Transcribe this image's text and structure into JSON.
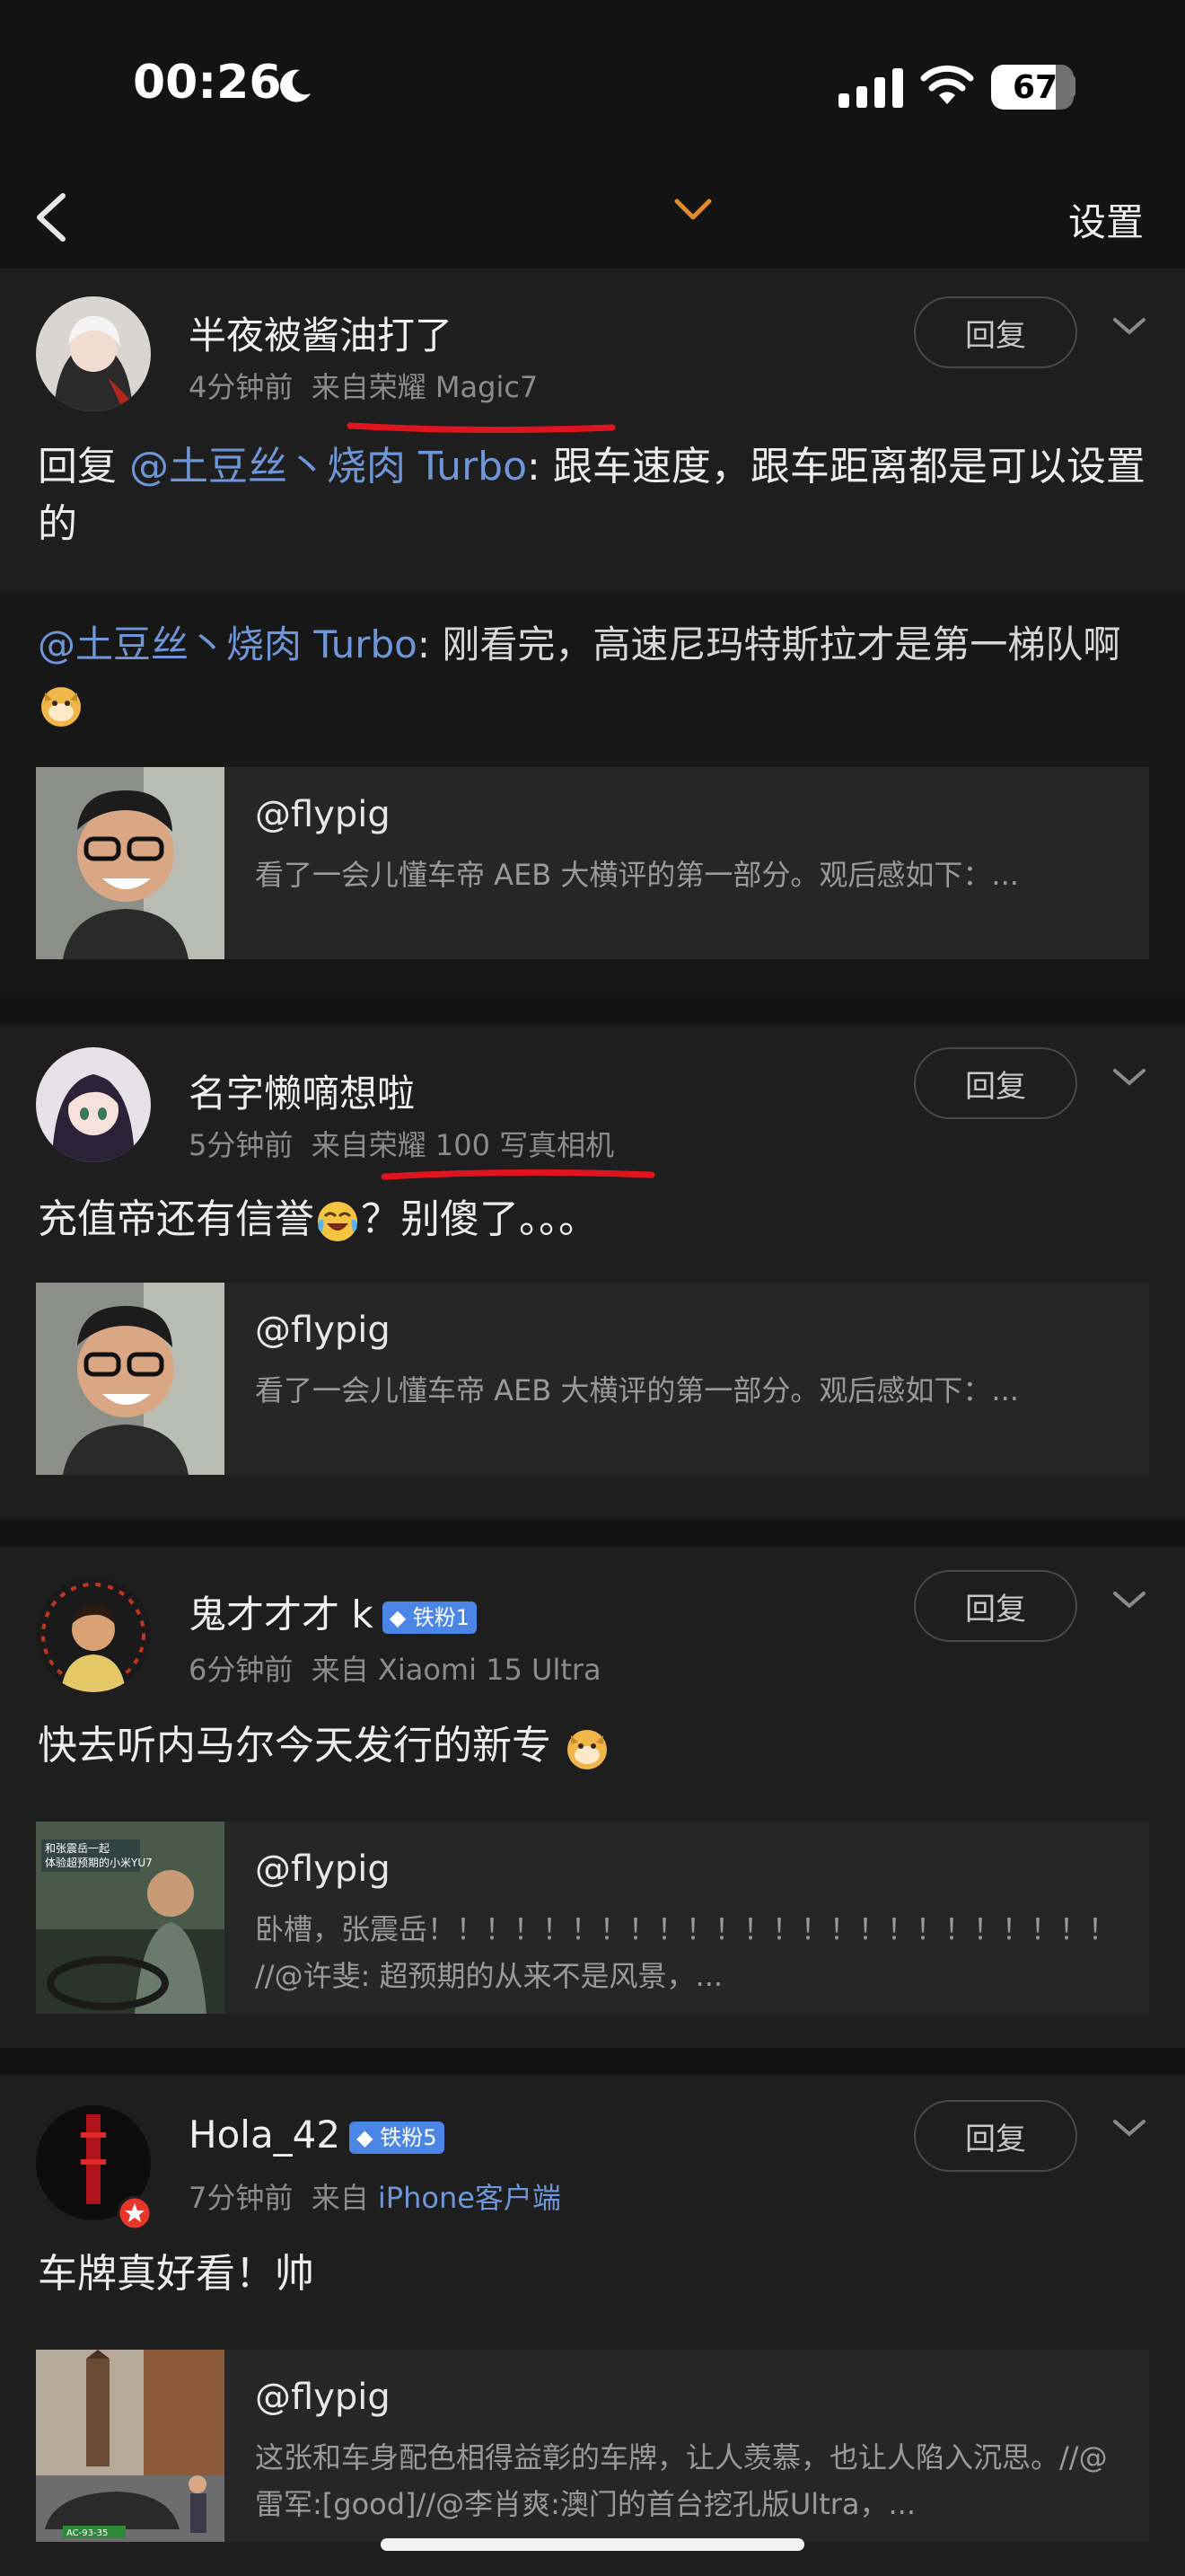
{
  "status_bar": {
    "time": "00:26",
    "battery": "67"
  },
  "nav": {
    "title": "",
    "settings_label": "设置"
  },
  "comments": [
    {
      "user": "半夜被酱油打了",
      "badge": "",
      "time": "4分钟前",
      "source_prefix": "来自",
      "device": "荣耀 Magic7",
      "reply_label": "回复",
      "text_prefix": "回复",
      "mention": "@土豆丝丶烧肉 Turbo",
      "text": ": 跟车速度，跟车距离都是可以设置的",
      "quote_mention": "@土豆丝丶烧肉 Turbo",
      "quote_text": ": 刚看完，高速尼玛特斯拉才是第一梯队啊",
      "orig_author": "@flypig",
      "orig_text": "看了一会儿懂车帝 AEB 大横评的第一部分。观后感如下：..."
    },
    {
      "user": "名字懒嘀想啦",
      "badge": "",
      "time": "5分钟前",
      "source_prefix": "来自",
      "device": "荣耀 100 写真相机",
      "reply_label": "回复",
      "text": "充值帝还有信誉",
      "text_suffix": "？别傻了。。。",
      "orig_author": "@flypig",
      "orig_text": "看了一会儿懂车帝 AEB 大横评的第一部分。观后感如下：..."
    },
    {
      "user": "鬼才才才 k",
      "badge": "铁粉1",
      "time": "6分钟前",
      "source_prefix": "来自",
      "device": "Xiaomi 15 Ultra",
      "reply_label": "回复",
      "text": "快去听内马尔今天发行的新专",
      "orig_author": "@flypig",
      "orig_text": "卧槽，张震岳！！！！！！！！！！！！！！！！！！！！！！！！ //@许斐: 超预期的从来不是风景，...",
      "orig_thumb_caption": "和张震岳一起 体验超预期的小米YU7"
    },
    {
      "user": "Hola_42",
      "badge": "铁粉5",
      "time": "7分钟前",
      "source_prefix": "来自",
      "device": "iPhone客户端",
      "reply_label": "回复",
      "text": "车牌真好看！帅",
      "orig_author": "@flypig",
      "orig_text": "这张和车身配色相得益彰的车牌，让人羡慕，也让人陷入沉思。//@雷军:[good]//@李肖爽:澳门的首台挖孔版Ultra，...",
      "orig_thumb_plate": "AC-93-35"
    }
  ],
  "colors": {
    "background": "#131313",
    "card": "#1e1e1e",
    "mention": "#6e96d8",
    "underline": "#e0141e",
    "badge": "#4b86e6"
  },
  "icons": [
    "back-chevron-icon",
    "chevron-down-icon",
    "more-chevron-icon",
    "moon-icon",
    "signal-icon",
    "wifi-icon"
  ]
}
